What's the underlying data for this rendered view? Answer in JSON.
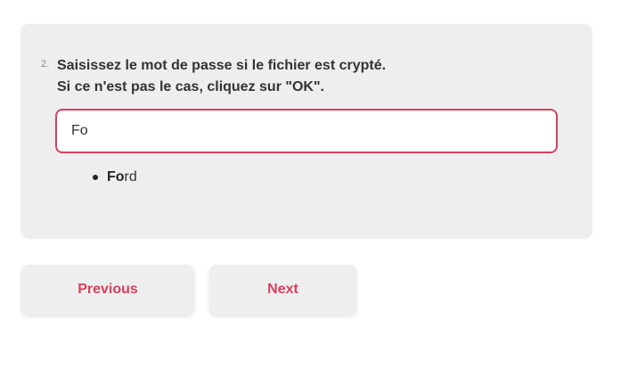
{
  "question": {
    "number": "2.",
    "title_line1": "Saisissez le mot de passe si le fichier est crypté.",
    "title_line2": "Si ce n'est pas le cas, cliquez sur \"OK\"."
  },
  "input": {
    "value": "Fo"
  },
  "suggestions": [
    {
      "match": "Fo",
      "rest": "rd"
    }
  ],
  "navigation": {
    "previous_label": "Previous",
    "next_label": "Next"
  },
  "colors": {
    "accent": "#d6405f",
    "card_background": "#eeeeee",
    "text": "#333333"
  }
}
